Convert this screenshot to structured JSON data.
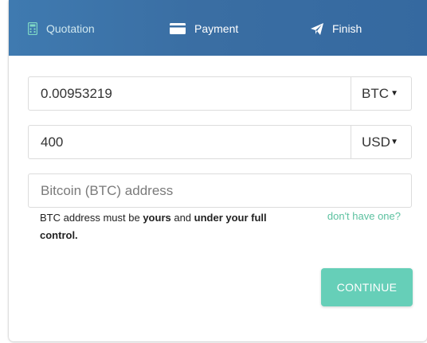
{
  "steps": {
    "quotation": "Quotation",
    "payment": "Payment",
    "finish": "Finish"
  },
  "crypto": {
    "amount": "0.00953219",
    "currency": "BTC"
  },
  "fiat": {
    "amount": "400",
    "currency": "USD"
  },
  "address": {
    "placeholder": "Bitcoin (BTC) address",
    "value": ""
  },
  "note": {
    "prefix": "BTC address must be ",
    "bold1": "yours",
    "middle": " and ",
    "bold2": "under your full control."
  },
  "dont_have_link": "don't have one?",
  "continue_label": "CONTINUE",
  "colors": {
    "header": "#3a6ea3",
    "accent": "#66cfb8",
    "link": "#5cc1a0"
  },
  "icons": {
    "quotation": "calculator-icon",
    "payment": "credit-card-icon",
    "finish": "paper-plane-icon",
    "select": "caret-down-icon"
  }
}
